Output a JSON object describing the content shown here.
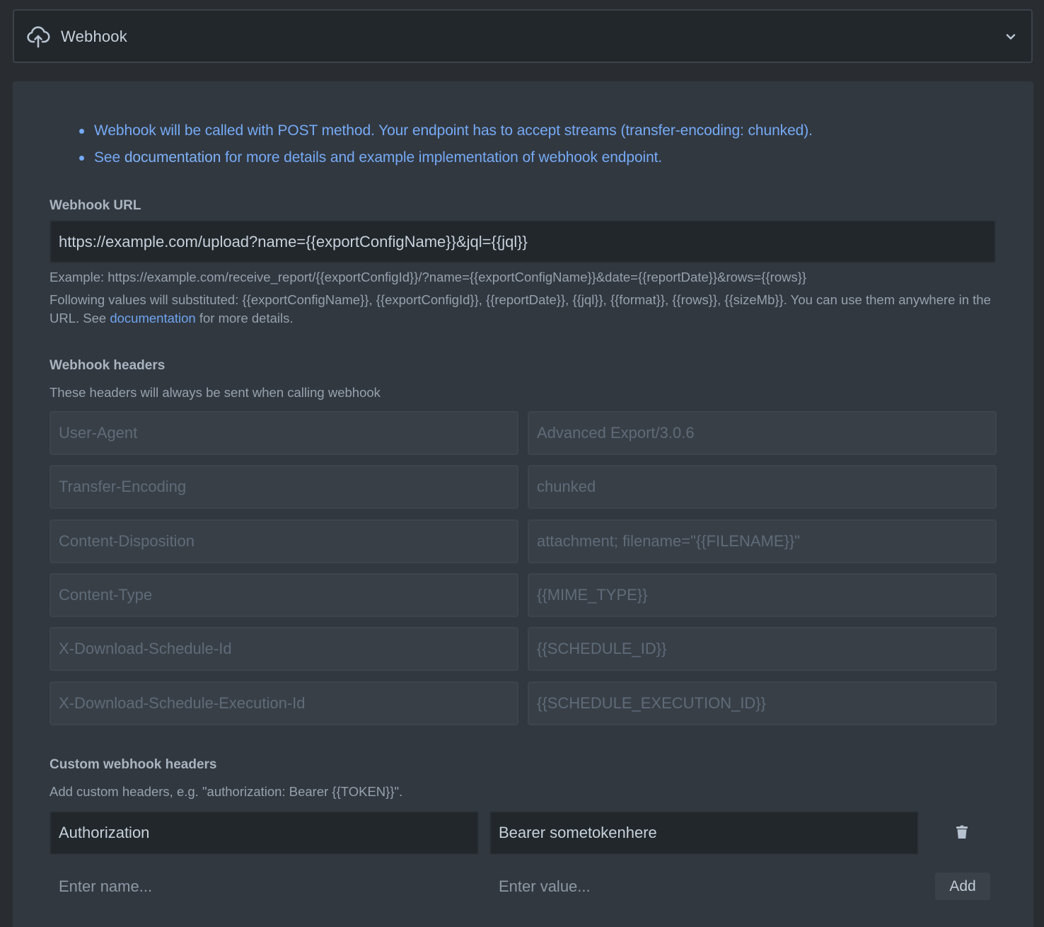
{
  "accordion": {
    "icon": "cloud-upload-icon",
    "title": "Webhook",
    "toggle_icon": "chevron-down-icon"
  },
  "notes": {
    "line1": "Webhook will be called with POST method. Your endpoint has to accept streams (transfer-encoding: chunked).",
    "line2_prefix": "See ",
    "line2_link": "documentation",
    "line2_suffix": " for more details and example implementation of webhook endpoint."
  },
  "colors": {
    "accent_link": "#75aaf5",
    "page_bg": "#292d32",
    "panel_bg": "#323840",
    "input_bg": "#22272b",
    "readonly_bg": "#383f47"
  },
  "webhook_url": {
    "label": "Webhook URL",
    "value": "https://example.com/upload?name={{exportConfigName}}&jql={{jql}}",
    "example": "Example: https://example.com/receive_report/{{exportConfigId}}/?name={{exportConfigName}}&date={{reportDate}}&rows={{rows}}",
    "help_prefix": "Following values will substituted: {{exportConfigName}}, {{exportConfigId}}, {{reportDate}}, {{jql}}, {{format}}, {{rows}}, {{sizeMb}}. You can use them anywhere in the URL. See ",
    "help_link": "documentation",
    "help_suffix": " for more details."
  },
  "webhook_headers": {
    "label": "Webhook headers",
    "description": "These headers will always be sent when calling webhook",
    "rows": [
      {
        "name": "User-Agent",
        "value": "Advanced Export/3.0.6"
      },
      {
        "name": "Transfer-Encoding",
        "value": "chunked"
      },
      {
        "name": "Content-Disposition",
        "value": "attachment; filename=\"{{FILENAME}}\""
      },
      {
        "name": "Content-Type",
        "value": "{{MIME_TYPE}}"
      },
      {
        "name": "X-Download-Schedule-Id",
        "value": "{{SCHEDULE_ID}}"
      },
      {
        "name": "X-Download-Schedule-Execution-Id",
        "value": "{{SCHEDULE_EXECUTION_ID}}"
      }
    ]
  },
  "custom_headers": {
    "label": "Custom webhook headers",
    "description": "Add custom headers, e.g. \"authorization: Bearer {{TOKEN}}\".",
    "rows": [
      {
        "name": "Authorization",
        "value": "Bearer sometokenhere",
        "delete_icon": "trash-icon"
      }
    ],
    "new_name_placeholder": "Enter name...",
    "new_value_placeholder": "Enter value...",
    "add_label": "Add"
  }
}
